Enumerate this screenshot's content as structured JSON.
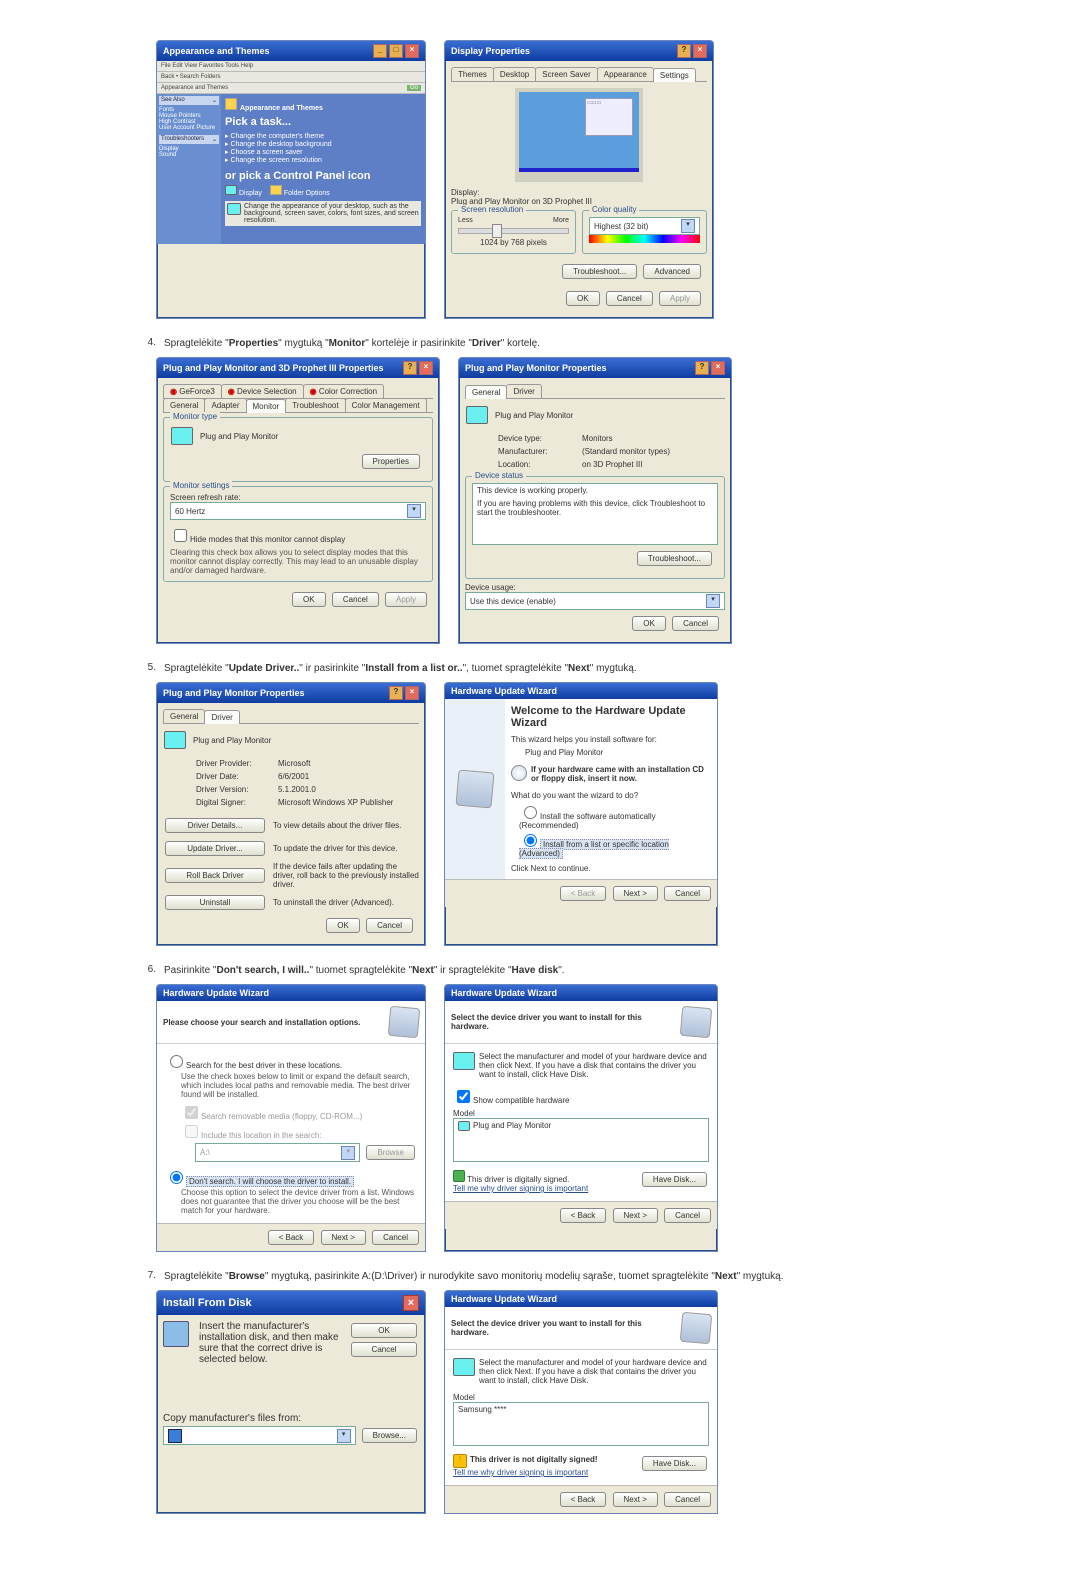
{
  "fig1a": {
    "title": "Appearance and Themes",
    "menubar": "File  Edit  View  Favorites  Tools  Help",
    "toolbar": "Back  •  Search  Folders",
    "addr": "Appearance and Themes",
    "go": "Go",
    "left_hdr1": "See Also",
    "left_items1": [
      "Fonts",
      "Mouse Pointers",
      "High Contrast",
      "User Account Picture"
    ],
    "left_hdr2": "Troubleshooters",
    "left_items2": [
      "Display",
      "Sound"
    ],
    "main_cat": "Appearance and Themes",
    "pick_task": "Pick a task...",
    "tasks": [
      "Change the computer's theme",
      "Change the desktop background",
      "Choose a screen saver",
      "Change the screen resolution"
    ],
    "or_pick": "or pick a Control Panel icon",
    "icons": [
      "Display",
      "Folder Options"
    ],
    "desc": "Change the appearance of your desktop, such as the background, screen saver, colors, font sizes, and screen resolution."
  },
  "fig1b": {
    "title": "Display Properties",
    "tabs": [
      "Themes",
      "Desktop",
      "Screen Saver",
      "Appearance",
      "Settings"
    ],
    "display_lbl": "Display:",
    "display_val": "Plug and Play Monitor on 3D Prophet III",
    "res_hdr": "Screen resolution",
    "less": "Less",
    "more": "More",
    "res_val": "1024 by 768 pixels",
    "qual_hdr": "Color quality",
    "qual_val": "Highest (32 bit)",
    "trouble": "Troubleshoot...",
    "adv": "Advanced",
    "ok": "OK",
    "cancel": "Cancel",
    "apply": "Apply"
  },
  "step4": {
    "num": "4.",
    "t1": "Spragtelėkite \"",
    "b1": "Properties",
    "t2": "\" mygtuką \"",
    "b2": "Monitor",
    "t3": "\" kortelėje ir pasirinkite \"",
    "b3": "Driver",
    "t4": "\" kortelę."
  },
  "fig4a": {
    "title": "Plug and Play Monitor and 3D Prophet III Properties",
    "tabs_top": [
      "GeForce3",
      "Device Selection",
      "Color Correction"
    ],
    "tabs_bot": [
      "General",
      "Adapter",
      "Monitor",
      "Troubleshoot",
      "Color Management"
    ],
    "mt_hdr": "Monitor type",
    "mt_val": "Plug and Play Monitor",
    "props": "Properties",
    "ms_hdr": "Monitor settings",
    "refresh_lbl": "Screen refresh rate:",
    "refresh_val": "60 Hertz",
    "hide_chk": "Hide modes that this monitor cannot display",
    "hide_desc": "Clearing this check box allows you to select display modes that this monitor cannot display correctly. This may lead to an unusable display and/or damaged hardware.",
    "ok": "OK",
    "cancel": "Cancel",
    "apply": "Apply"
  },
  "fig4b": {
    "title": "Plug and Play Monitor Properties",
    "tabs": [
      "General",
      "Driver"
    ],
    "name": "Plug and Play Monitor",
    "dev_type_l": "Device type:",
    "dev_type_v": "Monitors",
    "manuf_l": "Manufacturer:",
    "manuf_v": "(Standard monitor types)",
    "loc_l": "Location:",
    "loc_v": "on 3D Prophet III",
    "status_hdr": "Device status",
    "status1": "This device is working properly.",
    "status2": "If you are having problems with this device, click Troubleshoot to start the troubleshooter.",
    "trouble": "Troubleshoot...",
    "usage_l": "Device usage:",
    "usage_v": "Use this device (enable)",
    "ok": "OK",
    "cancel": "Cancel"
  },
  "step5": {
    "num": "5.",
    "t1": "Spragtelėkite \"",
    "b1": "Update Driver..",
    "t2": "\" ir pasirinkite \"",
    "b2": "Install from a list or..",
    "t3": "\", tuomet spragtelėkite \"",
    "b3": "Next",
    "t4": "\" mygtuką."
  },
  "fig5a": {
    "title": "Plug and Play Monitor Properties",
    "tabs": [
      "General",
      "Driver"
    ],
    "name": "Plug and Play Monitor",
    "prov_l": "Driver Provider:",
    "prov_v": "Microsoft",
    "date_l": "Driver Date:",
    "date_v": "6/6/2001",
    "ver_l": "Driver Version:",
    "ver_v": "5.1.2001.0",
    "sign_l": "Digital Signer:",
    "sign_v": "Microsoft Windows XP Publisher",
    "det_btn": "Driver Details...",
    "det_txt": "To view details about the driver files.",
    "upd_btn": "Update Driver...",
    "upd_txt": "To update the driver for this device.",
    "roll_btn": "Roll Back Driver",
    "roll_txt": "If the device fails after updating the driver, roll back to the previously installed driver.",
    "unin_btn": "Uninstall",
    "unin_txt": "To uninstall the driver (Advanced).",
    "ok": "OK",
    "cancel": "Cancel"
  },
  "fig5b": {
    "title": "Hardware Update Wizard",
    "welcome": "Welcome to the Hardware Update Wizard",
    "helps": "This wizard helps you install software for:",
    "dev": "Plug and Play Monitor",
    "cd_hint": "If your hardware came with an installation CD or floppy disk, insert it now.",
    "what": "What do you want the wizard to do?",
    "opt1": "Install the software automatically (Recommended)",
    "opt2": "Install from a list or specific location (Advanced)",
    "cont": "Click Next to continue.",
    "back": "< Back",
    "next": "Next >",
    "cancel": "Cancel"
  },
  "step6": {
    "num": "6.",
    "t1": "Pasirinkite \"",
    "b1": "Don't search, I will..",
    "t2": "\" tuomet spragtelėkite \"",
    "b2": "Next",
    "t3": "\" ir spragtelėkite \"",
    "b3": "Have disk",
    "t4": "\"."
  },
  "fig6a": {
    "title": "Hardware Update Wizard",
    "hdr": "Please choose your search and installation options.",
    "opt1": "Search for the best driver in these locations.",
    "opt1_desc": "Use the check boxes below to limit or expand the default search, which includes local paths and removable media. The best driver found will be installed.",
    "chk1": "Search removable media (floppy, CD-ROM...)",
    "chk2": "Include this location in the search:",
    "path": "A:\\",
    "browse": "Browse",
    "opt2": "Don't search. I will choose the driver to install.",
    "opt2_desc": "Choose this option to select the device driver from a list. Windows does not guarantee that the driver you choose will be the best match for your hardware.",
    "back": "< Back",
    "next": "Next >",
    "cancel": "Cancel"
  },
  "fig6b": {
    "title": "Hardware Update Wizard",
    "hdr": "Select the device driver you want to install for this hardware.",
    "desc": "Select the manufacturer and model of your hardware device and then click Next. If you have a disk that contains the driver you want to install, click Have Disk.",
    "compat": "Show compatible hardware",
    "model_hdr": "Model",
    "model_val": "Plug and Play Monitor",
    "signed": "This driver is digitally signed.",
    "tell": "Tell me why driver signing is important",
    "have": "Have Disk...",
    "back": "< Back",
    "next": "Next >",
    "cancel": "Cancel"
  },
  "step7": {
    "num": "7.",
    "t1": "Spragtelėkite \"",
    "b1": "Browse",
    "t2": "\" mygtuką, pasirinkite A:(D:\\Driver) ir nurodykite savo monitorių modelių sąraše, tuomet spragtelėkite \"",
    "b2": "Next",
    "t3": "\" mygtuką."
  },
  "fig7a": {
    "title": "Install From Disk",
    "msg": "Insert the manufacturer's installation disk, and then make sure that the correct drive is selected below.",
    "ok": "OK",
    "cancel": "Cancel",
    "copy": "Copy manufacturer's files from:",
    "path": "",
    "browse": "Browse..."
  },
  "fig7b": {
    "title": "Hardware Update Wizard",
    "hdr": "Select the device driver you want to install for this hardware.",
    "desc": "Select the manufacturer and model of your hardware device and then click Next. If you have a disk that contains the driver you want to install, click Have Disk.",
    "model_hdr": "Model",
    "model_val": "Samsung ****",
    "not_signed": "This driver is not digitally signed!",
    "tell": "Tell me why driver signing is important",
    "have": "Have Disk...",
    "back": "< Back",
    "next": "Next >",
    "cancel": "Cancel"
  }
}
